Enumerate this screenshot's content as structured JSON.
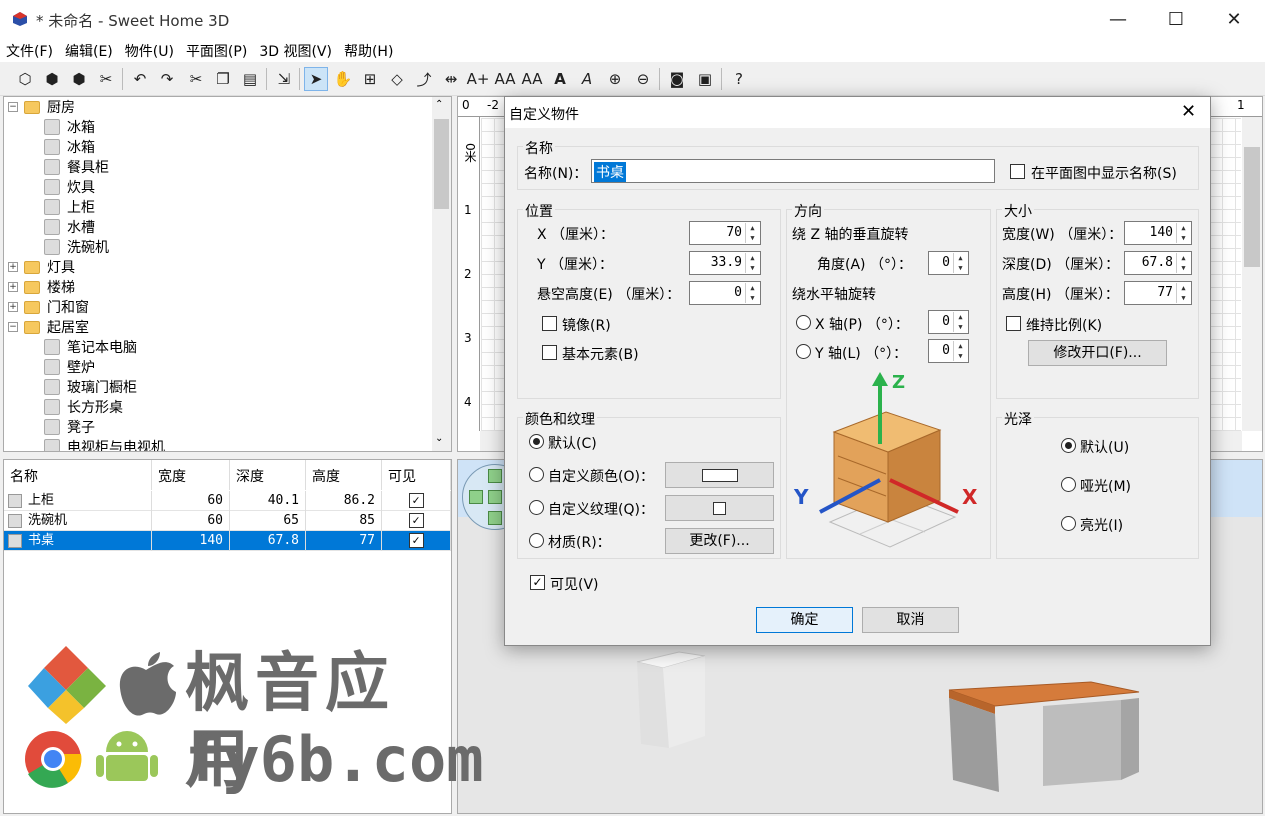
{
  "window": {
    "title": "* 未命名 - Sweet Home 3D",
    "minimize": "—",
    "maximize": "☐",
    "close": "✕"
  },
  "menu": [
    "文件(F)",
    "编辑(E)",
    "物件(U)",
    "平面图(P)",
    "3D 视图(V)",
    "帮助(H)"
  ],
  "catalog": {
    "rows": [
      {
        "label": "厨房",
        "type": "folder",
        "expanded": true
      },
      {
        "label": "冰箱",
        "type": "item"
      },
      {
        "label": "冰箱",
        "type": "item"
      },
      {
        "label": "餐具柜",
        "type": "item"
      },
      {
        "label": "炊具",
        "type": "item"
      },
      {
        "label": "上柜",
        "type": "item"
      },
      {
        "label": "水槽",
        "type": "item"
      },
      {
        "label": "洗碗机",
        "type": "item"
      },
      {
        "label": "灯具",
        "type": "folder",
        "expanded": false
      },
      {
        "label": "楼梯",
        "type": "folder",
        "expanded": false
      },
      {
        "label": "门和窗",
        "type": "folder",
        "expanded": false
      },
      {
        "label": "起居室",
        "type": "folder",
        "expanded": true
      },
      {
        "label": "笔记本电脑",
        "type": "item"
      },
      {
        "label": "壁炉",
        "type": "item"
      },
      {
        "label": "玻璃门橱柜",
        "type": "item"
      },
      {
        "label": "长方形桌",
        "type": "item"
      },
      {
        "label": "凳子",
        "type": "item"
      },
      {
        "label": "电视柜与电视机",
        "type": "item"
      }
    ]
  },
  "furniture_table": {
    "headers": [
      "名称",
      "宽度",
      "深度",
      "高度",
      "可见"
    ],
    "rows": [
      {
        "name": "上柜",
        "width": "60",
        "depth": "40.1",
        "height": "86.2",
        "visible": "✓"
      },
      {
        "name": "洗碗机",
        "width": "60",
        "depth": "65",
        "height": "85",
        "visible": "✓"
      },
      {
        "name": "书桌",
        "width": "140",
        "depth": "67.8",
        "height": "77",
        "visible": "✓"
      }
    ]
  },
  "plan": {
    "ruler_top": [
      "-2",
      "0",
      "1"
    ],
    "ruler_left": [
      "0米",
      "1",
      "2",
      "3",
      "4"
    ]
  },
  "watermark": {
    "line1": "枫音应用",
    "line2": "fy6b.com"
  },
  "dialog": {
    "title": "自定义物件",
    "close": "✕",
    "name_group": {
      "label": "名称",
      "name_label": "名称(N)：",
      "name_value": "书桌",
      "show_name_label": "在平面图中显示名称(S)"
    },
    "position": {
      "label": "位置",
      "x_label": "X （厘米）：",
      "x_value": "70",
      "y_label": "Y （厘米）：",
      "y_value": "33.9",
      "elev_label": "悬空高度(E) （厘米）：",
      "elev_value": "0",
      "mirror_label": "镜像(R)",
      "basic_label": "基本元素(B)"
    },
    "orientation": {
      "label": "方向",
      "z_axis_label": "绕 Z 轴的垂直旋转",
      "angle_label": "角度(A) （°）：",
      "angle_value": "0",
      "horiz_label": "绕水平轴旋转",
      "x_axis_label": "X 轴(P) （°）：",
      "x_axis_value": "0",
      "y_axis_label": "Y 轴(L) （°）：",
      "y_axis_value": "0"
    },
    "size": {
      "label": "大小",
      "width_label": "宽度(W) （厘米）：",
      "width_value": "140",
      "depth_label": "深度(D) （厘米）：",
      "depth_value": "67.8",
      "height_label": "高度(H) （厘米）：",
      "height_value": "77",
      "keep_ratio_label": "维持比例(K)",
      "modify_openings": "修改开口(F)..."
    },
    "color_texture": {
      "label": "颜色和纹理",
      "default": "默认(C)",
      "custom_color": "自定义颜色(O)：",
      "custom_texture": "自定义纹理(Q)：",
      "material": "材质(R)：",
      "change": "更改(F)..."
    },
    "shininess": {
      "label": "光泽",
      "default": "默认(U)",
      "matte": "哑光(M)",
      "shiny": "亮光(I)"
    },
    "visible_label": "可见(V)",
    "ok": "确定",
    "cancel": "取消"
  },
  "colors": {
    "selection": "#0078d7",
    "desk_top": "#d57b3b",
    "folder": "#f6c85f"
  }
}
